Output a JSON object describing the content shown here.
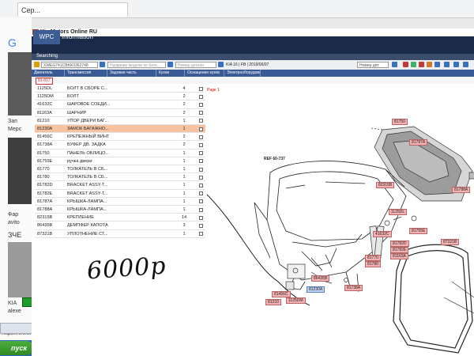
{
  "browser": {
    "tab_title": "Сер...",
    "bg_texts": [
      "G",
      "Зап",
      "Мерс",
      "Фар",
      "avito",
      "ЗЧЕ",
      "KIA",
      "alexe",
      "https://www.g"
    ]
  },
  "taskbar": {
    "start_label": "пуск"
  },
  "app": {
    "title": "Kia Motors Online RU",
    "tabs": [
      "WPC",
      "Information"
    ],
    "status": "Searching",
    "toolbar": {
      "vin_value": "XWEG741CBKK0362748",
      "model_placeholder": "Название модели по Кате...",
      "part_placeholder": "Номер детали",
      "model_info": "KIA 16 | FB | 2019/06/07",
      "number_select": "Номер дет"
    },
    "columns": [
      "Двигатель",
      "Трансмиссия",
      "Задовая часть",
      "Кузов",
      "Оснащение кузов",
      "Электрооборудован"
    ],
    "filter_tag": "81-817",
    "parts": [
      {
        "code": "1125DL",
        "name": "БОЛТ В СБОРЕ С...",
        "qty": "4",
        "selected": false
      },
      {
        "code": "1125DM",
        "name": "БОЛТ",
        "qty": "2",
        "selected": false
      },
      {
        "code": "41632C",
        "name": "ШАРОВОЕ СОЕДИ...",
        "qty": "2",
        "selected": false
      },
      {
        "code": "81163A",
        "name": "ШАРНИР",
        "qty": "2",
        "selected": false
      },
      {
        "code": "81210",
        "name": "УПОР ДВЕРИ БАГ...",
        "qty": "1",
        "selected": false
      },
      {
        "code": "81230A",
        "name": "ЗАМОК БАГАЖНО...",
        "qty": "1",
        "selected": true
      },
      {
        "code": "81456C",
        "name": "КРЕПЕЖНЫЙ ВИНТ",
        "qty": "2",
        "selected": false
      },
      {
        "code": "81738A",
        "name": "БУФЕР ДВ. ЗАДКА",
        "qty": "2",
        "selected": false
      },
      {
        "code": "81750",
        "name": "ПАНЕЛЬ ОБЛИЦО...",
        "qty": "1",
        "selected": false
      },
      {
        "code": "81755E",
        "name": "ручка двери",
        "qty": "1",
        "selected": false
      },
      {
        "code": "81770",
        "name": "ТОЛКАТЕЛЬ В СБ...",
        "qty": "1",
        "selected": false
      },
      {
        "code": "81780",
        "name": "ТОЛКАТЕЛЬ В СБ...",
        "qty": "1",
        "selected": false
      },
      {
        "code": "81782D",
        "name": "BRACKET ASSY-T...",
        "qty": "1",
        "selected": false
      },
      {
        "code": "81782E",
        "name": "BRACKET ASSY-T...",
        "qty": "1",
        "selected": false
      },
      {
        "code": "81787A",
        "name": "КРЫШКА-ЛАМПА...",
        "qty": "1",
        "selected": false
      },
      {
        "code": "81788A",
        "name": "КРЫШКА-ЛАМПА...",
        "qty": "1",
        "selected": false
      },
      {
        "code": "82315B",
        "name": "КРЕПЛЕНИЕ",
        "qty": "14",
        "selected": false
      },
      {
        "code": "86435B",
        "name": "ДЕМПФЕР КАПОТА",
        "qty": "3",
        "selected": false
      },
      {
        "code": "87321B",
        "name": "УПЛОТНЕНИЕ СТ...",
        "qty": "1",
        "selected": false
      }
    ],
    "page_label": "Page 1",
    "diagram": {
      "ref_label": "REF 60-737",
      "callouts": [
        "81750",
        "81787A",
        "81788A",
        "82315B",
        "1125DL",
        "41632C",
        "81755E",
        "81782D",
        "81782E",
        "81163A",
        "81770",
        "81780",
        "87321B",
        "86435B",
        "81456C",
        "81230A",
        "81738A",
        "81210",
        "1125DM"
      ]
    },
    "handwriting": "6000р"
  }
}
